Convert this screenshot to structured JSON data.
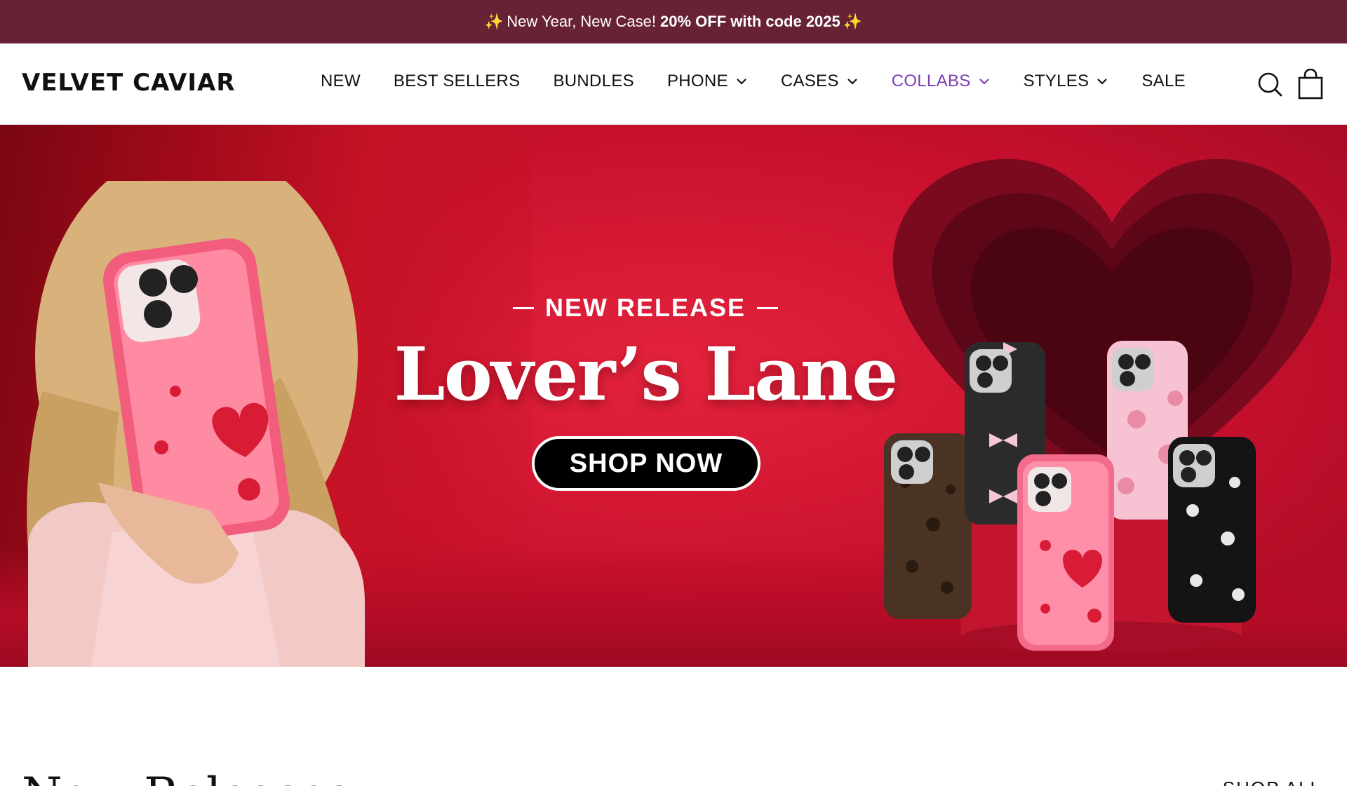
{
  "announcement": {
    "spark_left": "✨",
    "text": "New Year, New Case!",
    "bold_text": "20% OFF with code 2025",
    "spark_right": "✨"
  },
  "header": {
    "logo": "VELVET CAVIAR",
    "nav": [
      {
        "label": "NEW"
      },
      {
        "label": "BEST SELLERS"
      },
      {
        "label": "BUNDLES"
      },
      {
        "label": "PHONE"
      },
      {
        "label": "CASES"
      },
      {
        "label": "COLLABS"
      },
      {
        "label": "STYLES"
      },
      {
        "label": "SALE"
      }
    ],
    "icons": [
      "search-icon",
      "shopping-bag-icon"
    ]
  },
  "hero": {
    "eyebrow": "NEW RELEASE",
    "title": "Lover’s Lane",
    "cta": "SHOP NOW"
  },
  "section": {
    "title": "New Releases",
    "link": "SHOP ALL"
  },
  "colors": {
    "announcement_bg": "#672236",
    "active_nav": "#7b3fb5",
    "hero_red": "#d41a35"
  }
}
